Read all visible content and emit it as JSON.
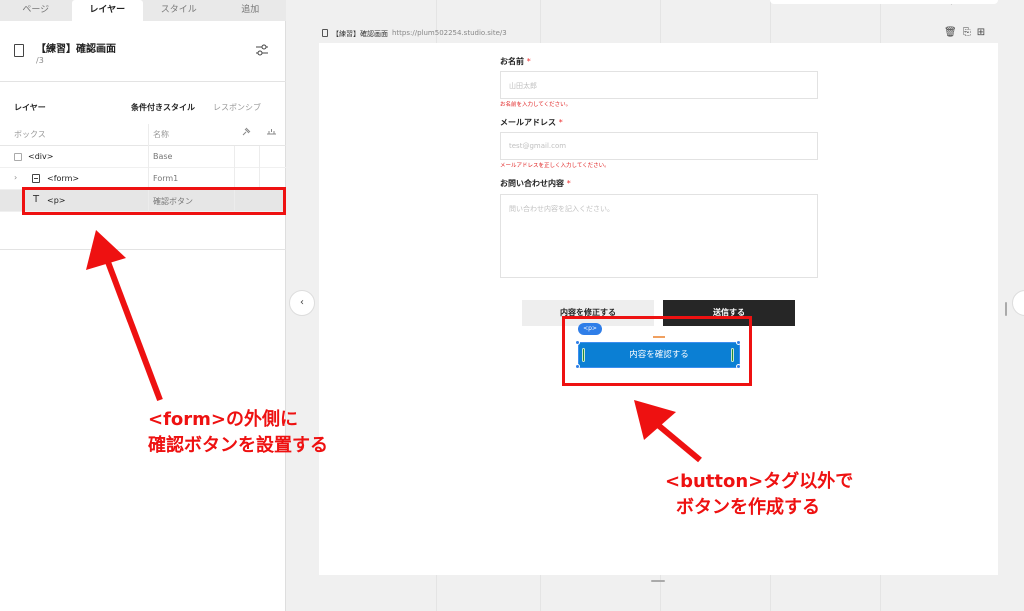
{
  "tabs": [
    "ページ",
    "レイヤー",
    "スタイル",
    "追加"
  ],
  "page": {
    "title": "【練習】確認画面",
    "path": "/3"
  },
  "layers": {
    "title": "レイヤー",
    "conditional_style": "条件付きスタイル",
    "responsive": "レスポンシブ",
    "col_box": "ボックス",
    "col_name": "名称",
    "rows": [
      {
        "tag": "<div>",
        "name": "Base"
      },
      {
        "tag": "<form>",
        "name": "Form1"
      },
      {
        "tag": "<p>",
        "name": "確認ボタン"
      }
    ]
  },
  "canvas": {
    "width_label": "1280px",
    "url_title": "【練習】確認画面",
    "url": "https://plum502254.studio.site/3"
  },
  "form": {
    "name_label": "お名前",
    "name_placeholder": "山田太郎",
    "name_error": "お名前を入力してください。",
    "email_label": "メールアドレス",
    "email_placeholder": "test@gmail.com",
    "email_error": "メールアドレスを正しく入力してください。",
    "inquiry_label": "お問い合わせ内容",
    "inquiry_placeholder": "問い合わせ内容を記入ください。",
    "required_mark": "*",
    "edit_button": "内容を修正する",
    "send_button": "送信する",
    "confirm_button": "内容を確認する",
    "p_badge": "<p>"
  },
  "annotations": {
    "left_line1": "<form>の外側に",
    "left_line2": "確認ボタンを設置する",
    "right_line1": "<button>タグ以外で",
    "right_line2": "ボタンを作成する"
  },
  "colors": {
    "annotation": "#ee1111",
    "selection": "#2f7ee8",
    "confirm_button": "#0b7fd4"
  }
}
